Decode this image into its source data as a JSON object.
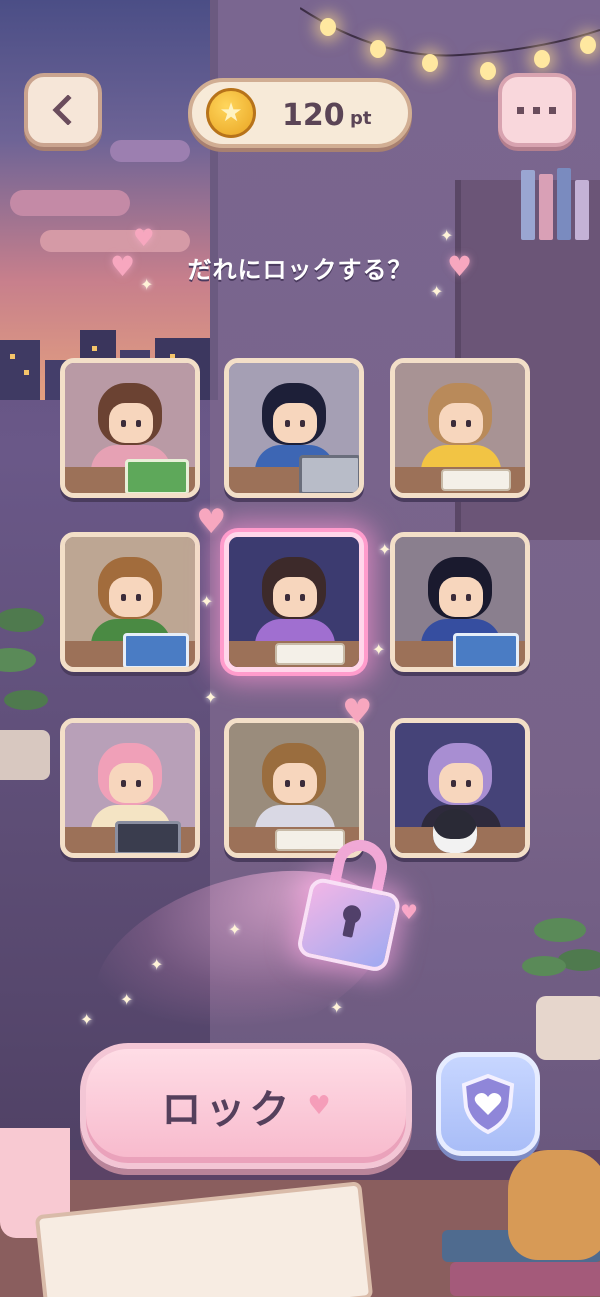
{
  "points": {
    "value": "120",
    "unit": "pt",
    "coin_icon": "star-coin-icon"
  },
  "top_bar": {
    "back_icon": "chevron-left-icon",
    "menu_icon": "more-horizontal-icon"
  },
  "prompt": {
    "text": "だれにロックする？"
  },
  "characters": [
    {
      "id": "girl-bun-reading",
      "hair": "#6b4232",
      "top": "#e6a1b4",
      "bg": "#b99aa5",
      "prop": "green-book",
      "selected": false
    },
    {
      "id": "boy-laptop",
      "hair": "#1d1f38",
      "top": "#3d66b4",
      "bg": "#a59fb4",
      "prop": "laptop",
      "selected": false
    },
    {
      "id": "girl-writing",
      "hair": "#b98a5a",
      "top": "#f2c444",
      "bg": "#a89394",
      "prop": "notebook",
      "selected": false
    },
    {
      "id": "boy-green-hoodie",
      "hair": "#a26c3c",
      "top": "#4a8a43",
      "bg": "#bda693",
      "prop": "blue-book",
      "selected": false
    },
    {
      "id": "girl-headphones",
      "hair": "#3d2a2a",
      "top": "#a06fd0",
      "bg": "#3c3b70",
      "prop": "notebook",
      "selected": true
    },
    {
      "id": "boy-glasses",
      "hair": "#1a1a2e",
      "top": "#364ea0",
      "bg": "#8a7f8e",
      "prop": "blue-book",
      "selected": false
    },
    {
      "id": "girl-pink-tablet",
      "hair": "#f0a0b8",
      "top": "#f4e4c4",
      "bg": "#b8a0b8",
      "prop": "tablet",
      "selected": false
    },
    {
      "id": "boy-grey-hoodie",
      "hair": "#9a6d3e",
      "top": "#d9d8e4",
      "bg": "#9a8c7c",
      "prop": "notebook",
      "selected": false
    },
    {
      "id": "girl-penguin",
      "hair": "#a88ed2",
      "top": "#2e2a3c",
      "bg": "#454378",
      "prop": "penguin",
      "selected": false
    }
  ],
  "actions": {
    "lock_label": "ロック",
    "shield_icon": "shield-heart-icon"
  },
  "colors": {
    "accent_pink": "#f7b9cc",
    "selected_glow": "#ff9ccc",
    "shield_blue": "#a9bdf7"
  }
}
